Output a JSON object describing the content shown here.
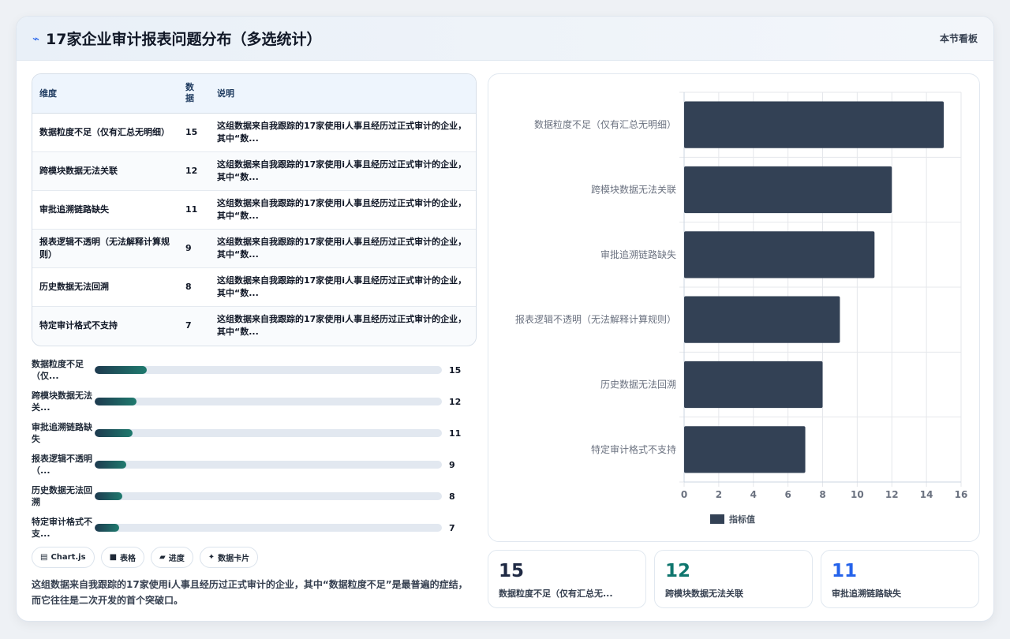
{
  "header": {
    "icon": "sparkline-icon",
    "title": "17家企业审计报表问题分布（多选统计）",
    "link": "本节看板"
  },
  "table": {
    "columns": [
      "维度",
      "数据",
      "说明"
    ],
    "rows": [
      {
        "dim": "数据粒度不足（仅有汇总无明细）",
        "value": "15",
        "desc": "这组数据来自我跟踪的17家使用i人事且经历过正式审计的企业，其中“数..."
      },
      {
        "dim": "跨模块数据无法关联",
        "value": "12",
        "desc": "这组数据来自我跟踪的17家使用i人事且经历过正式审计的企业，其中“数..."
      },
      {
        "dim": "审批追溯链路缺失",
        "value": "11",
        "desc": "这组数据来自我跟踪的17家使用i人事且经历过正式审计的企业，其中“数..."
      },
      {
        "dim": "报表逻辑不透明（无法解释计算规则）",
        "value": "9",
        "desc": "这组数据来自我跟踪的17家使用i人事且经历过正式审计的企业，其中“数..."
      },
      {
        "dim": "历史数据无法回溯",
        "value": "8",
        "desc": "这组数据来自我跟踪的17家使用i人事且经历过正式审计的企业，其中“数..."
      },
      {
        "dim": "特定审计格式不支持",
        "value": "7",
        "desc": "这组数据来自我跟踪的17家使用i人事且经历过正式审计的企业，其中“数..."
      }
    ]
  },
  "progress": {
    "max": 100,
    "rows": [
      {
        "label": "数据粒度不足（仅...",
        "value": 15
      },
      {
        "label": "跨模块数据无法关...",
        "value": 12
      },
      {
        "label": "审批追溯链路缺失",
        "value": 11
      },
      {
        "label": "报表逻辑不透明（...",
        "value": 9
      },
      {
        "label": "历史数据无法回溯",
        "value": 8
      },
      {
        "label": "特定审计格式不支...",
        "value": 7
      }
    ]
  },
  "chips": [
    {
      "icon": "chart-icon",
      "glyph": "▤",
      "label": "Chart.js"
    },
    {
      "icon": "table-icon",
      "glyph": "■",
      "label": "表格"
    },
    {
      "icon": "progress-icon",
      "glyph": "▰",
      "label": "进度"
    },
    {
      "icon": "sparkle-icon",
      "glyph": "✦",
      "label": "数据卡片"
    }
  ],
  "note": "这组数据来自我跟踪的17家使用i人事且经历过正式审计的企业，其中“数据粒度不足”是最普遍的症结，而它往往是二次开发的首个突破口。",
  "stats": [
    {
      "value": "15",
      "label": "数据粒度不足（仅有汇总无...",
      "color": "#1f2a44"
    },
    {
      "value": "12",
      "label": "跨模块数据无法关联",
      "color": "#0f766e"
    },
    {
      "value": "11",
      "label": "审批追溯链路缺失",
      "color": "#2563eb"
    }
  ],
  "chart_data": {
    "type": "bar",
    "orientation": "horizontal",
    "categories": [
      "数据粒度不足（仅有汇总无明细）",
      "跨模块数据无法关联",
      "审批追溯链路缺失",
      "报表逻辑不透明（无法解释计算规则）",
      "历史数据无法回溯",
      "特定审计格式不支持"
    ],
    "series": [
      {
        "name": "指标值",
        "values": [
          15,
          12,
          11,
          9,
          8,
          7
        ],
        "color": "#334155"
      }
    ],
    "xlim": [
      0,
      16
    ],
    "xticks": [
      0,
      2,
      4,
      6,
      8,
      10,
      12,
      14,
      16
    ],
    "grid": true,
    "legend": "bottom-left"
  }
}
